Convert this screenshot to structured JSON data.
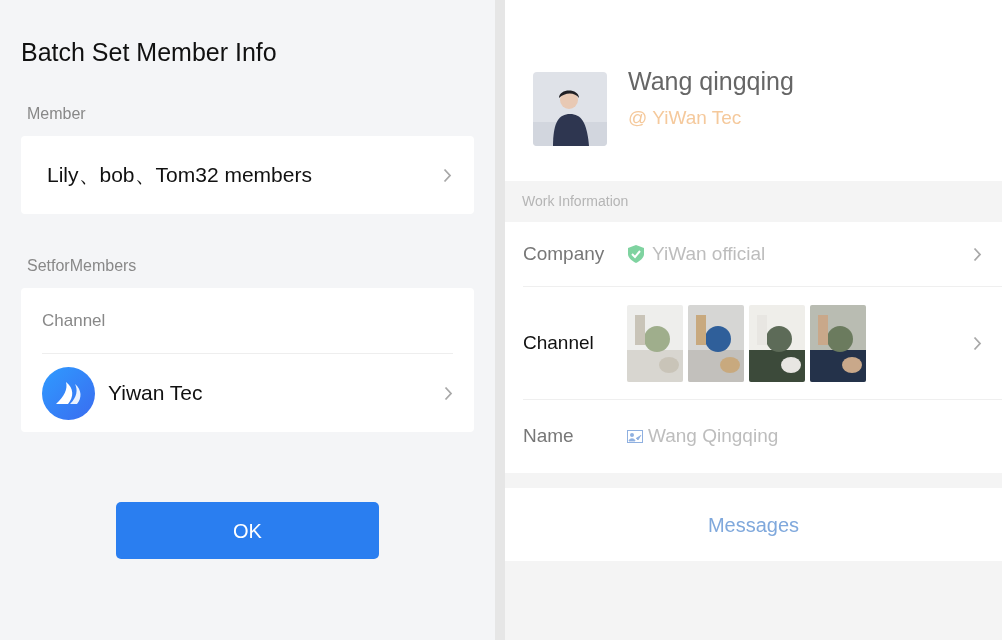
{
  "batch_panel": {
    "title": "Batch Set Member Info",
    "member_section": {
      "label": "Member",
      "value": "Lily、bob、Tom32 members"
    },
    "set_section": {
      "label": "SetforMembers",
      "field_label": "Channel",
      "channel": "Yiwan Tec"
    },
    "ok_button": "OK"
  },
  "profile_panel": {
    "name": "Wang qingqing",
    "handle": "@ YiWan Tec",
    "section_title": "Work Information",
    "rows": [
      {
        "kind": "company",
        "label": "Company",
        "value": "YiWan official"
      },
      {
        "kind": "pictures",
        "label": "Channel"
      },
      {
        "kind": "name",
        "label": "Name",
        "value": "Wang Qingqing"
      }
    ],
    "action": "Messages"
  }
}
